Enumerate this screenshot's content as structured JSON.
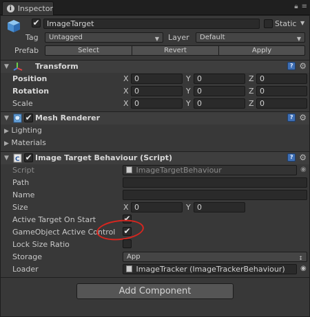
{
  "window": {
    "tab_label": "Inspector",
    "tab_icon": "info-icon",
    "menu_icon": "menu-icon",
    "lock_icon": "lock-icon"
  },
  "gameobject": {
    "active_checked": true,
    "name": "ImageTarget",
    "static_label": "Static",
    "static_checked": false,
    "tag_label": "Tag",
    "tag_value": "Untagged",
    "layer_label": "Layer",
    "layer_value": "Default",
    "prefab_label": "Prefab",
    "prefab_select": "Select",
    "prefab_revert": "Revert",
    "prefab_apply": "Apply"
  },
  "transform": {
    "title": "Transform",
    "position_label": "Position",
    "rotation_label": "Rotation",
    "scale_label": "Scale",
    "axis_x": "X",
    "axis_y": "Y",
    "axis_z": "Z",
    "position": {
      "x": "0",
      "y": "0",
      "z": "0"
    },
    "rotation": {
      "x": "0",
      "y": "0",
      "z": "0"
    },
    "scale": {
      "x": "0",
      "y": "0",
      "z": "0"
    }
  },
  "mesh_renderer": {
    "title": "Mesh Renderer",
    "enabled": true,
    "lighting_label": "Lighting",
    "materials_label": "Materials"
  },
  "itb": {
    "title": "Image Target Behaviour (Script)",
    "enabled": true,
    "script_label": "Script",
    "script_value": "ImageTargetBehaviour",
    "path_label": "Path",
    "path_value": "",
    "name_label": "Name",
    "name_value": "",
    "size_label": "Size",
    "size_x": "0",
    "size_y": "0",
    "active_on_start_label": "Active Target On Start",
    "active_on_start": true,
    "go_active_control_label": "GameObject Active Control",
    "go_active_control": true,
    "lock_size_ratio_label": "Lock Size Ratio",
    "lock_size_ratio": false,
    "storage_label": "Storage",
    "storage_value": "App",
    "loader_label": "Loader",
    "loader_value": "ImageTracker (ImageTrackerBehaviour)"
  },
  "add_component_label": "Add Component",
  "colors": {
    "background": "#383838",
    "header": "#3e3e3e",
    "field": "#2a2a2a",
    "help_blue": "#3f6fb4",
    "highlight_circle": "#d7261f"
  }
}
